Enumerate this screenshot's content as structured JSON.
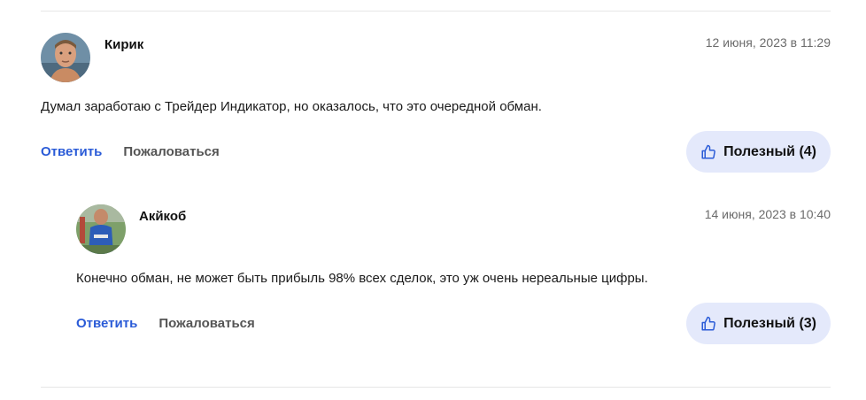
{
  "comments": [
    {
      "author": "Кирик",
      "date": "12 июня, 2023 в 11:29",
      "text": "Думал заработаю с Трейдер Индикатор, но оказалось, что это очередной обман.",
      "reply_label": "Ответить",
      "complain_label": "Пожаловаться",
      "useful_label": "Полезный (4)"
    },
    {
      "author": "Акйкоб",
      "date": "14 июня, 2023 в 10:40",
      "text": "Конечно обман, не может быть прибыль 98% всех сделок, это уж очень нереальные цифры.",
      "reply_label": "Ответить",
      "complain_label": "Пожаловаться",
      "useful_label": "Полезный (3)"
    }
  ],
  "icons": {
    "useful": "thumbs-up-icon"
  },
  "colors": {
    "link": "#2a5bd7",
    "useful_bg": "#e4e9fb"
  }
}
